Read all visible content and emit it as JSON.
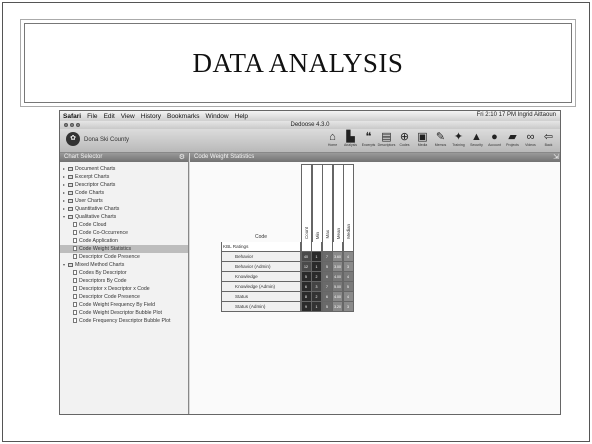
{
  "slide": {
    "title": "DATA ANALYSIS"
  },
  "menubar": {
    "items": [
      "Safari",
      "File",
      "Edit",
      "View",
      "History",
      "Bookmarks",
      "Window",
      "Help"
    ],
    "status": "Fri 2:10 17 PM  Ingrid Aittaoun"
  },
  "window": {
    "title": "Dedoose 4.3.0"
  },
  "toolbar": {
    "project": "Dona Ski County",
    "tools": [
      {
        "icon": "home-icon",
        "glyph": "⌂",
        "label": "Home"
      },
      {
        "icon": "analysis-icon",
        "glyph": "▙",
        "label": "Analysis"
      },
      {
        "icon": "excerpts-icon",
        "glyph": "❝",
        "label": "Excerpts"
      },
      {
        "icon": "descriptors-icon",
        "glyph": "▤",
        "label": "Descriptors"
      },
      {
        "icon": "codes-icon",
        "glyph": "⊕",
        "label": "Codes"
      },
      {
        "icon": "media-icon",
        "glyph": "▣",
        "label": "Media"
      },
      {
        "icon": "memos-icon",
        "glyph": "✎",
        "label": "Memos"
      },
      {
        "icon": "training-icon",
        "glyph": "✦",
        "label": "Training"
      },
      {
        "icon": "security-icon",
        "glyph": "▲",
        "label": "Security"
      },
      {
        "icon": "account-icon",
        "glyph": "●",
        "label": "Account"
      },
      {
        "icon": "projects-icon",
        "glyph": "▰",
        "label": "Projects"
      },
      {
        "icon": "video-icon",
        "glyph": "∞",
        "label": "Videos"
      },
      {
        "icon": "back-icon",
        "glyph": "⇦",
        "label": "Back"
      }
    ]
  },
  "sidebar": {
    "header": "Chart Selector",
    "items": [
      {
        "label": "Document Charts",
        "type": "folder",
        "indent": 0,
        "twisty": "▸"
      },
      {
        "label": "Excerpt Charts",
        "type": "folder",
        "indent": 0,
        "twisty": "▸"
      },
      {
        "label": "Descriptor Charts",
        "type": "folder",
        "indent": 0,
        "twisty": "▸"
      },
      {
        "label": "Code Charts",
        "type": "folder",
        "indent": 0,
        "twisty": "▸"
      },
      {
        "label": "User Charts",
        "type": "folder",
        "indent": 0,
        "twisty": "▸"
      },
      {
        "label": "Quantitative Charts",
        "type": "folder",
        "indent": 0,
        "twisty": "▸"
      },
      {
        "label": "Qualitative Charts",
        "type": "folder",
        "indent": 0,
        "twisty": "▾"
      },
      {
        "label": "Code Cloud",
        "type": "doc",
        "indent": 1
      },
      {
        "label": "Code Co-Occurrence",
        "type": "doc",
        "indent": 1
      },
      {
        "label": "Code Application",
        "type": "doc",
        "indent": 1
      },
      {
        "label": "Code Weight Statistics",
        "type": "doc",
        "indent": 1,
        "selected": true
      },
      {
        "label": "Descriptor Code Presence",
        "type": "doc",
        "indent": 1
      },
      {
        "label": "Mixed Method Charts",
        "type": "folder",
        "indent": 0,
        "twisty": "▾"
      },
      {
        "label": "Codes By Descriptor",
        "type": "doc",
        "indent": 1
      },
      {
        "label": "Descriptors By Code",
        "type": "doc",
        "indent": 1
      },
      {
        "label": "Descriptor x Descriptor x Code",
        "type": "doc",
        "indent": 1
      },
      {
        "label": "Descriptor Code Presence",
        "type": "doc",
        "indent": 1
      },
      {
        "label": "Code Weight Frequency By Field",
        "type": "doc",
        "indent": 1
      },
      {
        "label": "Code Weight Descriptor Bubble Plot",
        "type": "doc",
        "indent": 1
      },
      {
        "label": "Code Frequency Descriptor Bubble Plot",
        "type": "doc",
        "indent": 1
      }
    ]
  },
  "main": {
    "header": "Code Weight Statistics",
    "code_header": "Code",
    "columns": [
      "Count",
      "Min",
      "Max",
      "Mean",
      "Median"
    ],
    "rows": [
      {
        "label": "KBL Ratings",
        "group": true,
        "cells": [
          "",
          "",
          "",
          "",
          ""
        ],
        "colors": []
      },
      {
        "label": "Behavior",
        "cells": [
          "40",
          "1",
          "7",
          "3.60",
          "4"
        ],
        "colors": [
          "#4a4a4a",
          "#2a2a2a",
          "#6a6a6a",
          "#8a8a8a",
          "#8a8a8a"
        ]
      },
      {
        "label": "Behavior (Admin)",
        "cells": [
          "12",
          "1",
          "5",
          "3.00",
          "3"
        ],
        "colors": [
          "#4a4a4a",
          "#2a2a2a",
          "#6a6a6a",
          "#8a8a8a",
          "#8a8a8a"
        ]
      },
      {
        "label": "Knowledge",
        "cells": [
          "5",
          "2",
          "6",
          "4.00",
          "4"
        ],
        "colors": [
          "#2a2a2a",
          "#2a2a2a",
          "#6a6a6a",
          "#7a7a7a",
          "#7a7a7a"
        ]
      },
      {
        "label": "Knowledge (Admin)",
        "cells": [
          "6",
          "3",
          "7",
          "5.00",
          "5"
        ],
        "colors": [
          "#2a2a2a",
          "#444444",
          "#6a6a6a",
          "#7a7a7a",
          "#7a7a7a"
        ]
      },
      {
        "label": "Status",
        "cells": [
          "8",
          "2",
          "6",
          "4.00",
          "4"
        ],
        "colors": [
          "#2a2a2a",
          "#333333",
          "#6a6a6a",
          "#8a8a8a",
          "#8a8a8a"
        ]
      },
      {
        "label": "Status (Admin)",
        "cells": [
          "9",
          "1",
          "5",
          "3.20",
          "3"
        ],
        "colors": [
          "#2a2a2a",
          "#333333",
          "#6a6a6a",
          "#8a8a8a",
          "#8a8a8a"
        ]
      }
    ]
  }
}
